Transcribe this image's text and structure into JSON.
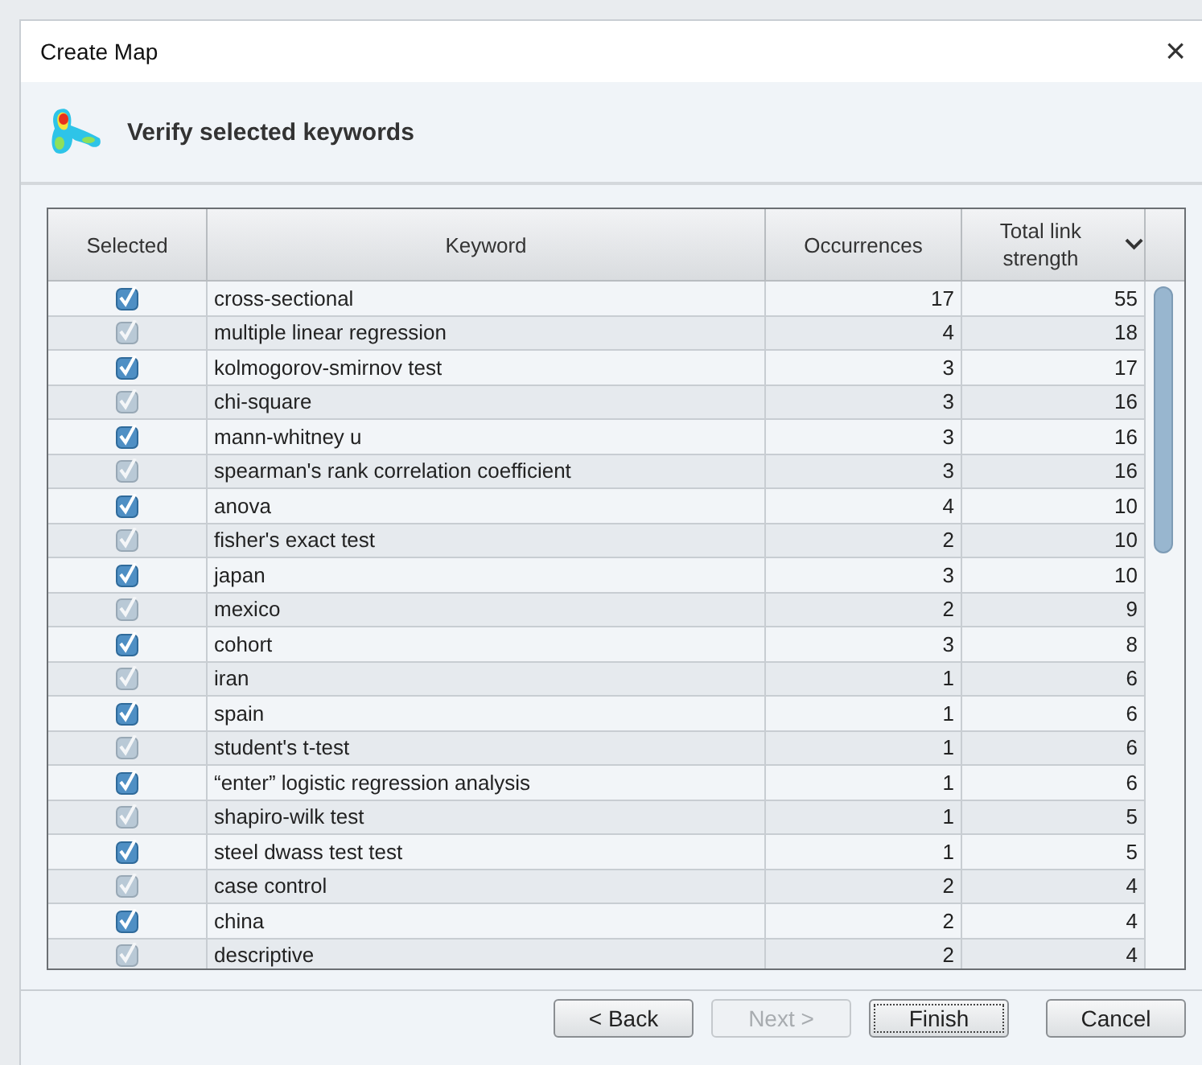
{
  "window": {
    "title": "Create Map",
    "close_symbol": "×"
  },
  "header": {
    "title": "Verify selected keywords"
  },
  "table": {
    "columns": [
      {
        "label": "Selected"
      },
      {
        "label": "Keyword"
      },
      {
        "label": "Occurrences"
      },
      {
        "label": "Total link strength",
        "sorted": true
      }
    ],
    "rows": [
      {
        "checked": true,
        "keyword": "cross-sectional",
        "occurrences": "17",
        "strength": "55"
      },
      {
        "checked": true,
        "keyword": "multiple linear regression",
        "occurrences": "4",
        "strength": "18"
      },
      {
        "checked": true,
        "keyword": "kolmogorov-smirnov test",
        "occurrences": "3",
        "strength": "17"
      },
      {
        "checked": true,
        "keyword": "chi-square",
        "occurrences": "3",
        "strength": "16"
      },
      {
        "checked": true,
        "keyword": "mann-whitney u",
        "occurrences": "3",
        "strength": "16"
      },
      {
        "checked": true,
        "keyword": "spearman's rank correlation coefficient",
        "occurrences": "3",
        "strength": "16"
      },
      {
        "checked": true,
        "keyword": "anova",
        "occurrences": "4",
        "strength": "10"
      },
      {
        "checked": true,
        "keyword": "fisher's exact test",
        "occurrences": "2",
        "strength": "10"
      },
      {
        "checked": true,
        "keyword": "japan",
        "occurrences": "3",
        "strength": "10"
      },
      {
        "checked": true,
        "keyword": "mexico",
        "occurrences": "2",
        "strength": "9"
      },
      {
        "checked": true,
        "keyword": "cohort",
        "occurrences": "3",
        "strength": "8"
      },
      {
        "checked": true,
        "keyword": "iran",
        "occurrences": "1",
        "strength": "6"
      },
      {
        "checked": true,
        "keyword": "spain",
        "occurrences": "1",
        "strength": "6"
      },
      {
        "checked": true,
        "keyword": "student's t-test",
        "occurrences": "1",
        "strength": "6"
      },
      {
        "checked": true,
        "keyword": "“enter” logistic regression analysis",
        "occurrences": "1",
        "strength": "6"
      },
      {
        "checked": true,
        "keyword": "shapiro-wilk test",
        "occurrences": "1",
        "strength": "5"
      },
      {
        "checked": true,
        "keyword": "steel dwass test test",
        "occurrences": "1",
        "strength": "5"
      },
      {
        "checked": true,
        "keyword": "case control",
        "occurrences": "2",
        "strength": "4"
      },
      {
        "checked": true,
        "keyword": "china",
        "occurrences": "2",
        "strength": "4"
      },
      {
        "checked": true,
        "keyword": "descriptive",
        "occurrences": "2",
        "strength": "4"
      }
    ]
  },
  "buttons": [
    {
      "label": "< Back",
      "disabled": false,
      "focused": false
    },
    {
      "label": "Next >",
      "disabled": true,
      "focused": false
    },
    {
      "label": "Finish",
      "disabled": false,
      "focused": true
    },
    {
      "label": "Cancel",
      "disabled": false,
      "focused": false
    }
  ]
}
